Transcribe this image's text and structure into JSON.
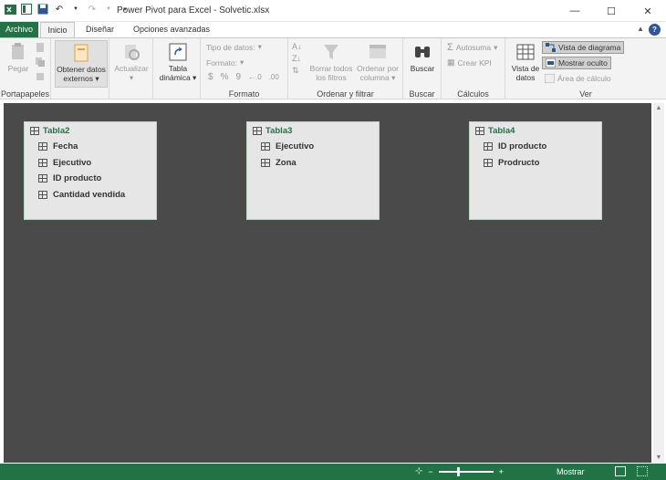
{
  "window": {
    "title": "Power Pivot para Excel - Solvetic.xlsx",
    "controls": {
      "minimize": "—",
      "maximize": "☐",
      "close": "✕"
    }
  },
  "tabs": [
    {
      "label": "Archivo"
    },
    {
      "label": "Inicio"
    },
    {
      "label": "Diseñar"
    },
    {
      "label": "Opciones avanzadas"
    }
  ],
  "ribbon": {
    "clipboard": {
      "label": "Portapapeles",
      "paste": "Pegar"
    },
    "external": {
      "line1": "Obtener datos",
      "line2": "externos"
    },
    "refresh": {
      "label": "Actualizar"
    },
    "pivot": {
      "line1": "Tabla",
      "line2": "dinámica"
    },
    "format": {
      "label": "Formato",
      "datatype": "Tipo de datos:",
      "format": "Formato:",
      "symbols": [
        "$",
        "%",
        "9",
        "←.0",
        ".00"
      ]
    },
    "sortfilter": {
      "label": "Ordenar y filtrar",
      "clear_line1": "Borrar todos",
      "clear_line2": "los filtros",
      "sortcol_line1": "Ordenar por",
      "sortcol_line2": "columna"
    },
    "find": {
      "label": "Buscar",
      "button": "Buscar"
    },
    "calc": {
      "label": "Cálculos",
      "autosum": "Autosuma",
      "kpi": "Crear KPI"
    },
    "view": {
      "label": "Ver",
      "data_line1": "Vista de",
      "data_line2": "datos",
      "diagram": "Vista de diagrama",
      "hidden": "Mostrar oculto",
      "calcarea": "Área de cálculo"
    }
  },
  "tables": [
    {
      "name": "Tabla2",
      "fields": [
        "Fecha",
        "Ejecutivo",
        "ID producto",
        "Cantidad vendida"
      ]
    },
    {
      "name": "Tabla3",
      "fields": [
        "Ejecutivo",
        "Zona"
      ]
    },
    {
      "name": "Tabla4",
      "fields": [
        "ID producto",
        "Prodructo"
      ]
    }
  ],
  "statusbar": {
    "show": "Mostrar",
    "zoom_minus": "−",
    "zoom_plus": "+"
  },
  "colors": {
    "accent": "#217346",
    "canvas": "#4a4a4a",
    "card": "#e6e6e6"
  }
}
